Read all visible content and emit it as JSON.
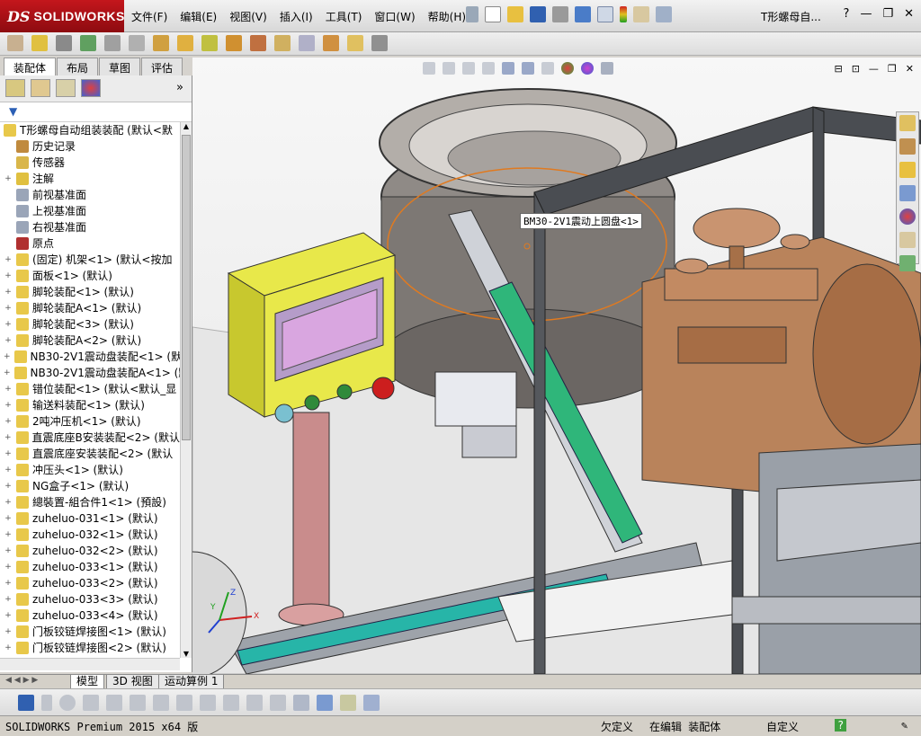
{
  "app": {
    "brand_prefix": "DS",
    "brand": "SOLIDWORKS"
  },
  "menu": [
    "文件(F)",
    "编辑(E)",
    "视图(V)",
    "插入(I)",
    "工具(T)",
    "窗口(W)",
    "帮助(H)"
  ],
  "document_title": "T形螺母自...",
  "command_tabs": [
    "装配体",
    "布局",
    "草图",
    "评估"
  ],
  "tree": {
    "root": "T形螺母自动组装装配  (默认<默",
    "items": [
      {
        "label": "历史记录",
        "expand": "",
        "color": "#c08a3e"
      },
      {
        "label": "传感器",
        "expand": "",
        "color": "#d9b64a"
      },
      {
        "label": "注解",
        "expand": "+",
        "color": "#e0c040"
      },
      {
        "label": "前视基准面",
        "expand": "",
        "color": "#9aa5b8"
      },
      {
        "label": "上视基准面",
        "expand": "",
        "color": "#9aa5b8"
      },
      {
        "label": "右视基准面",
        "expand": "",
        "color": "#9aa5b8"
      },
      {
        "label": "原点",
        "expand": "",
        "color": "#b03030"
      },
      {
        "label": "(固定) 机架<1> (默认<按加",
        "expand": "+",
        "color": "#e8c84a"
      },
      {
        "label": "面板<1> (默认)",
        "expand": "+",
        "color": "#e8c84a"
      },
      {
        "label": "脚轮装配<1> (默认)",
        "expand": "+",
        "color": "#e8c84a"
      },
      {
        "label": "脚轮装配A<1> (默认)",
        "expand": "+",
        "color": "#e8c84a"
      },
      {
        "label": "脚轮装配<3> (默认)",
        "expand": "+",
        "color": "#e8c84a"
      },
      {
        "label": "脚轮装配A<2> (默认)",
        "expand": "+",
        "color": "#e8c84a"
      },
      {
        "label": "NB30-2V1震动盘装配<1> (默认",
        "expand": "+",
        "color": "#e8c84a"
      },
      {
        "label": "NB30-2V1震动盘装配A<1> (默",
        "expand": "+",
        "color": "#e8c84a"
      },
      {
        "label": "错位装配<1> (默认<默认_显",
        "expand": "+",
        "color": "#e8c84a"
      },
      {
        "label": "输送料装配<1> (默认)",
        "expand": "+",
        "color": "#e8c84a"
      },
      {
        "label": "2吨冲压机<1> (默认)",
        "expand": "+",
        "color": "#e8c84a"
      },
      {
        "label": "直震底座B安装装配<2> (默认",
        "expand": "+",
        "color": "#e8c84a"
      },
      {
        "label": "直震底座安装装配<2> (默认",
        "expand": "+",
        "color": "#e8c84a"
      },
      {
        "label": "冲压头<1> (默认)",
        "expand": "+",
        "color": "#e8c84a"
      },
      {
        "label": "NG盒子<1> (默认)",
        "expand": "+",
        "color": "#e8c84a"
      },
      {
        "label": "總裝置-組合件1<1> (預設)",
        "expand": "+",
        "color": "#e8c84a"
      },
      {
        "label": "zuheluo-031<1> (默认)",
        "expand": "+",
        "color": "#e8c84a"
      },
      {
        "label": "zuheluo-032<1> (默认)",
        "expand": "+",
        "color": "#e8c84a"
      },
      {
        "label": "zuheluo-032<2> (默认)",
        "expand": "+",
        "color": "#e8c84a"
      },
      {
        "label": "zuheluo-033<1> (默认)",
        "expand": "+",
        "color": "#e8c84a"
      },
      {
        "label": "zuheluo-033<2> (默认)",
        "expand": "+",
        "color": "#e8c84a"
      },
      {
        "label": "zuheluo-033<3> (默认)",
        "expand": "+",
        "color": "#e8c84a"
      },
      {
        "label": "zuheluo-033<4> (默认)",
        "expand": "+",
        "color": "#e8c84a"
      },
      {
        "label": "门板铰链焊接图<1> (默认)",
        "expand": "+",
        "color": "#e8c84a"
      },
      {
        "label": "门板铰链焊接图<2> (默认)",
        "expand": "+",
        "color": "#e8c84a"
      }
    ]
  },
  "viewport": {
    "callout": "BM30-2V1震动上圆盘<1>",
    "triad": {
      "x": "X",
      "y": "Y",
      "z": "Z"
    }
  },
  "bottom_tabs": [
    "模型",
    "3D 视图",
    "运动算例 1"
  ],
  "status": {
    "app": "SOLIDWORKS Premium 2015 x64 版",
    "under_defined": "欠定义",
    "editing": "在编辑 装配体",
    "custom": "自定义"
  }
}
